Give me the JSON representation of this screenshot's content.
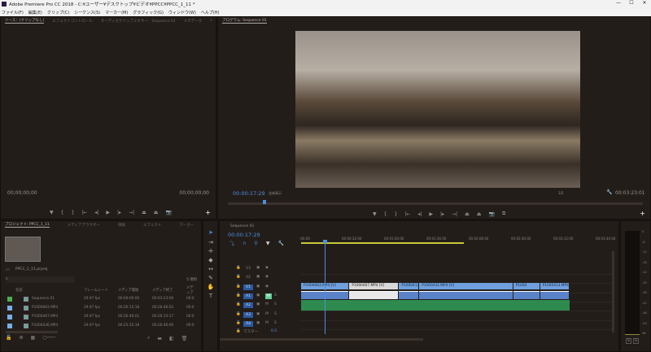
{
  "window": {
    "title": "Adobe Premiere Pro CC 2018 - C:¥ユーザー¥デスクトップ¥ビデオ¥PPCC¥PPCC_1_11 *",
    "min": "—",
    "max": "☐",
    "close": "✕"
  },
  "menu": [
    "ファイル(F)",
    "編集(E)",
    "クリップ(C)",
    "シーケンス(S)",
    "マーカー(M)",
    "グラフィック(G)",
    "ウィンドウ(W)",
    "ヘルプ(H)"
  ],
  "source": {
    "tabs": [
      "ソース：(クリップなし)",
      "エフェクトコントロール",
      "オーディオクリップミキサー：Sequence 01",
      "メタデータ"
    ],
    "more": "»",
    "tc_in": "00;00;00;00",
    "tc_out": "00;00;00;00"
  },
  "program": {
    "tab": "プログラム: Sequence 01",
    "timecode": "00:00:17:29",
    "fit": "全体表示",
    "quality": "1/2",
    "duration": "00:03:23:01",
    "playhead_fraction": 0.085
  },
  "controls": {
    "marker": "▼",
    "in": "{",
    "out": "}",
    "goto_in": "|←",
    "step_back": "◂|",
    "play": "▶",
    "step_fwd": "|▸",
    "goto_out": "→|",
    "lift": "⏏",
    "extract": "⏏",
    "export_frame": "📷",
    "compare": "⧉",
    "add": "+"
  },
  "project": {
    "tabs": [
      "プロジェクト: PPCC_1_11",
      "メディアブラウザー",
      "情報",
      "エフェクト",
      "マーカー"
    ],
    "file": "PPCC_1_11.prproj",
    "count": "5 項目",
    "columns": [
      "名前",
      "フレームレート",
      "メディア開始",
      "メディア終了",
      "メディア"
    ],
    "items": [
      {
        "name": "Sequence 01",
        "fps": "29.97 fps",
        "start": "00:00:00:00",
        "end": "00:03:23:00",
        "dur": "00:0",
        "color": "#4caf50"
      },
      {
        "name": "P1000683.MP4",
        "fps": "29.97 fps",
        "start": "00:26:15:18",
        "end": "00:26:46:02",
        "dur": "00:0",
        "color": "#7aaee6"
      },
      {
        "name": "P1000467.MP4",
        "fps": "29.97 fps",
        "start": "00:26:46:01",
        "end": "00:26:15:17",
        "dur": "00:0",
        "color": "#7aaee6"
      },
      {
        "name": "P1000436.MP4",
        "fps": "29.97 fps",
        "start": "00:25:35:18",
        "end": "00:26:46:00",
        "dur": "00:0",
        "color": "#7aaee6"
      }
    ]
  },
  "timeline": {
    "tab": "Sequence 01",
    "timecode": "00:00:17:29",
    "ruler": [
      ":00:00",
      "00:00:32:00",
      "00:01:04:00",
      "00:01:36:00",
      "00:02:08:00",
      "00:02:40:00",
      "00:03:12:00",
      "00:03:44:00"
    ],
    "tracks": [
      "V3",
      "V2",
      "V1",
      "A1",
      "A2",
      "A3",
      "A4"
    ],
    "master": "マスター",
    "master_val": "0.0",
    "mute": "M",
    "solo": "S",
    "clips": [
      {
        "label": "P1000683.MP4 [V]",
        "start": 0,
        "end": 0.18
      },
      {
        "label": "P1000467.MP4 [V]",
        "start": 0.18,
        "end": 0.365
      },
      {
        "label": "P1000413.MP4 [V]",
        "start": 0.365,
        "end": 0.44
      },
      {
        "label": "P1000432.MP4 [V]",
        "start": 0.44,
        "end": 0.79
      },
      {
        "label": "P1000",
        "start": 0.79,
        "end": 0.89
      },
      {
        "label": "P1000413.MP4 [V]",
        "start": 0.89,
        "end": 1.0
      }
    ]
  },
  "meter": {
    "scale": [
      "0",
      "-6",
      "-12",
      "-18",
      "-24",
      "-30",
      "-36",
      "-42",
      "-48",
      "-54",
      "dB"
    ],
    "solo": "S"
  }
}
